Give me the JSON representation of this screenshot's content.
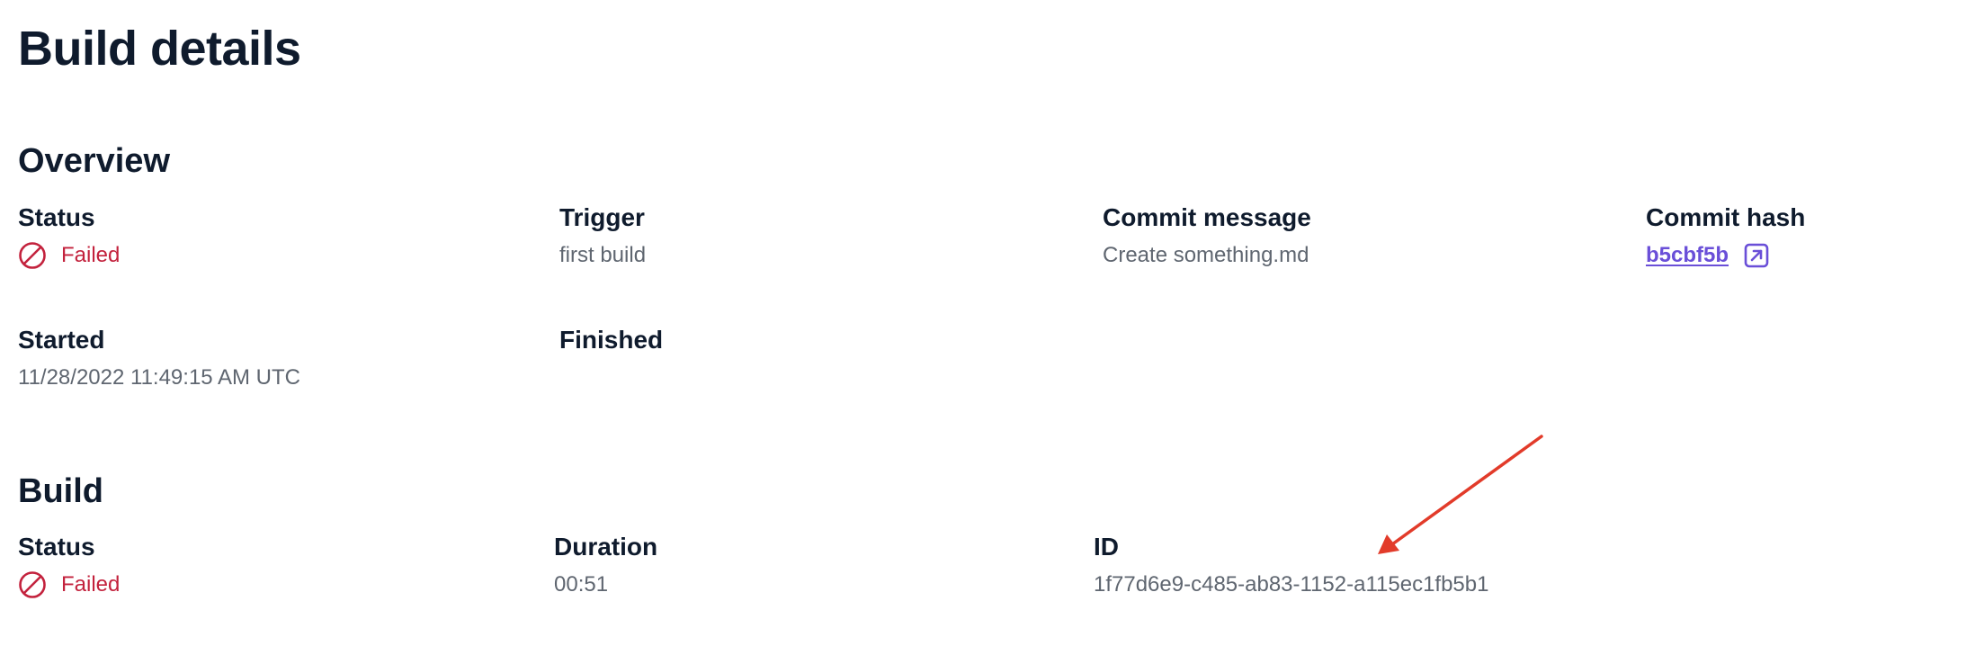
{
  "page": {
    "title": "Build details"
  },
  "overview": {
    "heading": "Overview",
    "status": {
      "label": "Status",
      "value": "Failed",
      "icon": "prohibited-icon",
      "color": "#c3223d"
    },
    "trigger": {
      "label": "Trigger",
      "value": "first build"
    },
    "commit_message": {
      "label": "Commit message",
      "value": "Create something.md"
    },
    "commit_hash": {
      "label": "Commit hash",
      "value": "b5cbf5b",
      "icon": "external-link-icon",
      "color": "#6a4fd8"
    },
    "started": {
      "label": "Started",
      "value": "11/28/2022 11:49:15 AM UTC"
    },
    "finished": {
      "label": "Finished",
      "value": ""
    }
  },
  "build": {
    "heading": "Build",
    "status": {
      "label": "Status",
      "value": "Failed",
      "icon": "prohibited-icon",
      "color": "#c3223d"
    },
    "duration": {
      "label": "Duration",
      "value": "00:51"
    },
    "id": {
      "label": "ID",
      "value": "1f77d6e9-c485-ab83-1152-a115ec1fb5b1"
    }
  },
  "annotation": {
    "arrow_color": "#e23b2a",
    "arrow_icon": "red-arrow-annotation"
  }
}
